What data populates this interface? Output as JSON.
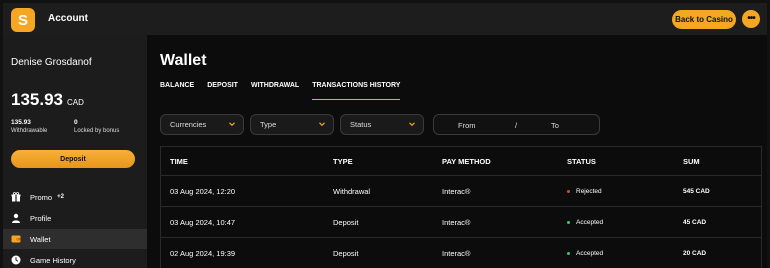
{
  "header": {
    "logo_letter": "S",
    "title": "Account",
    "back_label": "Back to Casino",
    "more_label": "•••"
  },
  "sidebar": {
    "user_name": "Denise Grosdanof",
    "balance_amount": "135.93",
    "balance_currency": "CAD",
    "withdrawable_value": "135.93",
    "withdrawable_label": "Withdrawable",
    "locked_value": "0",
    "locked_label": "Locked by bonus",
    "deposit_label": "Deposit",
    "items": [
      {
        "label": "Promo",
        "badge": "+2",
        "icon": "gift-icon"
      },
      {
        "label": "Profile",
        "icon": "user-icon"
      },
      {
        "label": "Wallet",
        "icon": "wallet-icon",
        "active": true
      },
      {
        "label": "Game History",
        "icon": "clock-icon"
      }
    ]
  },
  "main": {
    "title": "Wallet",
    "tabs": [
      {
        "label": "BALANCE"
      },
      {
        "label": "DEPOSIT"
      },
      {
        "label": "WITHDRAWAL"
      },
      {
        "label": "TRANSACTIONS HISTORY",
        "active": true
      }
    ],
    "filters": {
      "currencies": "Currencies",
      "type": "Type",
      "status": "Status",
      "from": "From",
      "separator": "/",
      "to": "To"
    },
    "table": {
      "columns": [
        "TIME",
        "TYPE",
        "PAY METHOD",
        "STATUS",
        "SUM"
      ],
      "rows": [
        {
          "time": "03 Aug 2024, 12:20",
          "type": "Withdrawal",
          "method": "Interac®",
          "status": "Rejected",
          "sum": "545 CAD"
        },
        {
          "time": "03 Aug 2024, 10:47",
          "type": "Deposit",
          "method": "Interac®",
          "status": "Accepted",
          "sum": "45 CAD"
        },
        {
          "time": "02 Aug 2024, 19:39",
          "type": "Deposit",
          "method": "Interac®",
          "status": "Accepted",
          "sum": "20 CAD"
        }
      ]
    }
  },
  "colors": {
    "accent": "#f5a623",
    "rejected": "#e0443a",
    "accepted": "#2ecc71"
  }
}
